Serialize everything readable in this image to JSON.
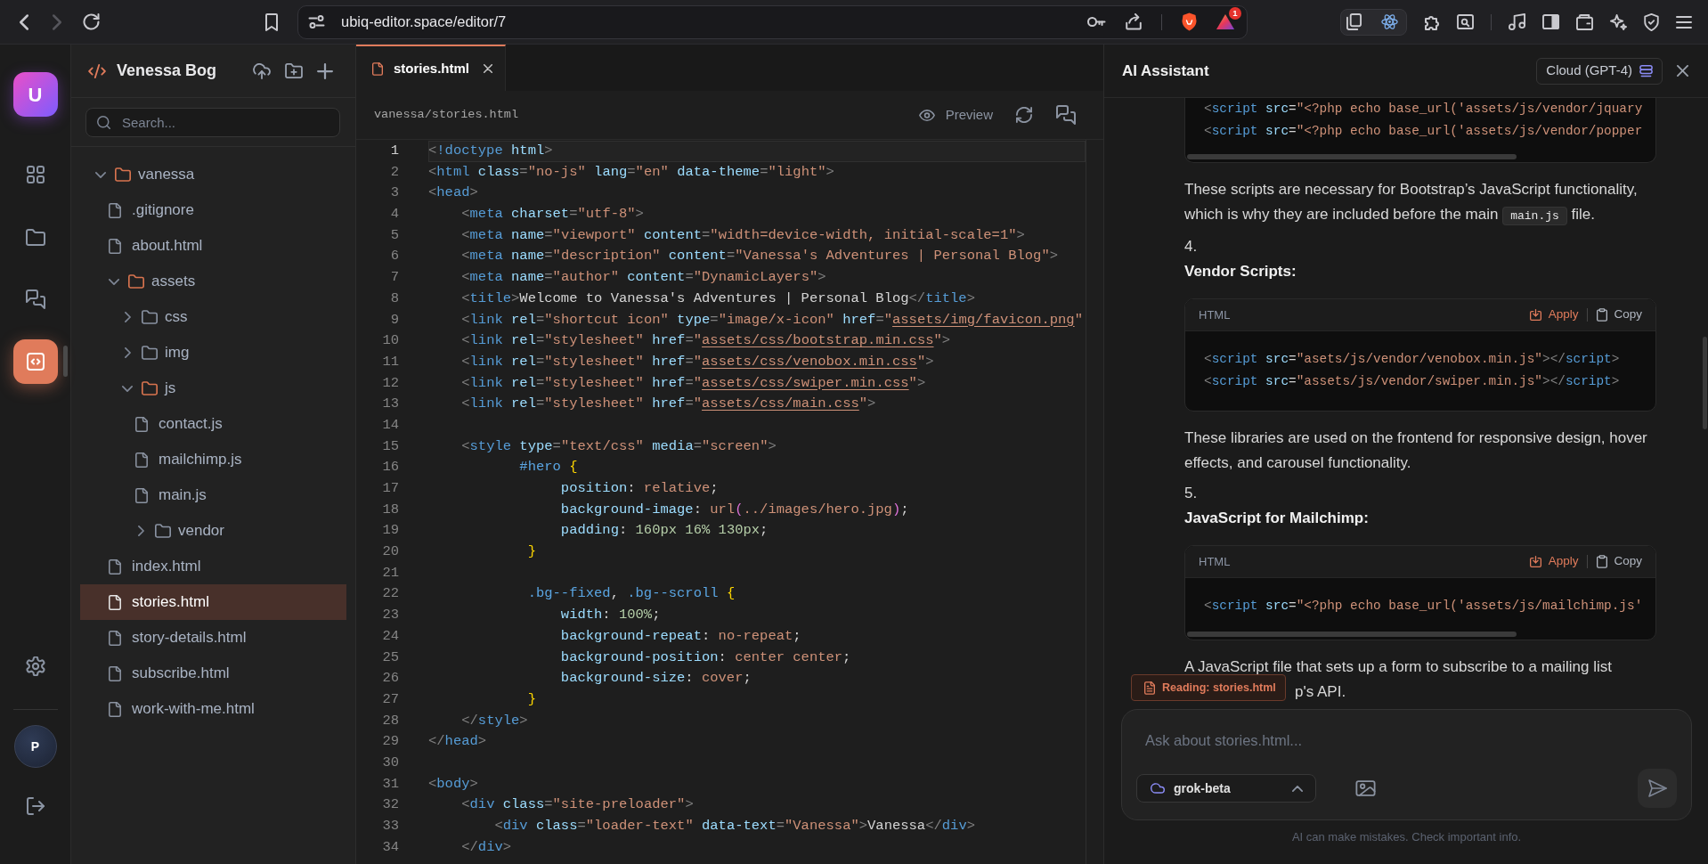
{
  "browser": {
    "url": "ubiq-editor.space/editor/7",
    "forward_disabled": true,
    "rewards_badge": "1"
  },
  "rail": {
    "logo": "U",
    "items": [
      {
        "kind": "grid",
        "selected": false
      },
      {
        "kind": "folder",
        "selected": false
      },
      {
        "kind": "chat",
        "selected": false
      },
      {
        "kind": "code",
        "selected": true
      }
    ],
    "avatar": "P"
  },
  "project": {
    "title": "Venessa Bog",
    "search_placeholder": "Search...",
    "tree": [
      {
        "name": "vanessa",
        "kind": "folder",
        "expanded": true,
        "selected": false,
        "children": [
          {
            "name": ".gitignore",
            "kind": "file",
            "selected": false
          },
          {
            "name": "about.html",
            "kind": "file",
            "selected": false
          },
          {
            "name": "assets",
            "kind": "folder",
            "expanded": true,
            "selected": false,
            "children": [
              {
                "name": "css",
                "kind": "folder",
                "expanded": false,
                "selected": false
              },
              {
                "name": "img",
                "kind": "folder",
                "expanded": false,
                "selected": false
              },
              {
                "name": "js",
                "kind": "folder",
                "expanded": true,
                "selected": false,
                "children": [
                  {
                    "name": "contact.js",
                    "kind": "file",
                    "selected": false
                  },
                  {
                    "name": "mailchimp.js",
                    "kind": "file",
                    "selected": false
                  },
                  {
                    "name": "main.js",
                    "kind": "file",
                    "selected": false
                  },
                  {
                    "name": "vendor",
                    "kind": "folder",
                    "expanded": false,
                    "selected": false
                  }
                ]
              }
            ]
          },
          {
            "name": "index.html",
            "kind": "file",
            "selected": false
          },
          {
            "name": "stories.html",
            "kind": "file",
            "selected": true
          },
          {
            "name": "story-details.html",
            "kind": "file",
            "selected": false
          },
          {
            "name": "subscribe.html",
            "kind": "file",
            "selected": false
          },
          {
            "name": "work-with-me.html",
            "kind": "file",
            "selected": false
          }
        ]
      }
    ]
  },
  "editor": {
    "tabs": [
      {
        "label": "stories.html",
        "selected": true
      }
    ],
    "path": "vanessa/stories.html",
    "preview": "Preview",
    "lines": [
      {
        "number": "1",
        "current": true,
        "tokens": [
          {
            "text": "<",
            "kind": "punct"
          },
          {
            "text": "!doctype",
            "kind": "tag"
          },
          {
            "text": " html",
            "kind": "attr"
          },
          {
            "text": ">",
            "kind": "punct"
          }
        ]
      },
      {
        "number": "2",
        "current": false,
        "tokens": [
          {
            "text": "<",
            "kind": "punct"
          },
          {
            "text": "html",
            "kind": "tag"
          },
          {
            "text": " class",
            "kind": "attr"
          },
          {
            "text": "=",
            "kind": "punct"
          },
          {
            "text": "\"no-js\"",
            "kind": "string"
          },
          {
            "text": " lang",
            "kind": "attr"
          },
          {
            "text": "=",
            "kind": "punct"
          },
          {
            "text": "\"en\"",
            "kind": "string"
          },
          {
            "text": " data-theme",
            "kind": "attr"
          },
          {
            "text": "=",
            "kind": "punct"
          },
          {
            "text": "\"light\"",
            "kind": "string"
          },
          {
            "text": ">",
            "kind": "punct"
          }
        ]
      },
      {
        "number": "3",
        "current": false,
        "tokens": [
          {
            "text": "<",
            "kind": "punct"
          },
          {
            "text": "head",
            "kind": "tag"
          },
          {
            "text": ">",
            "kind": "punct"
          }
        ]
      },
      {
        "number": "4",
        "current": false,
        "tokens": [
          {
            "text": "    <",
            "kind": "punct"
          },
          {
            "text": "meta",
            "kind": "tag"
          },
          {
            "text": " charset",
            "kind": "attr"
          },
          {
            "text": "=",
            "kind": "punct"
          },
          {
            "text": "\"utf-8\"",
            "kind": "string"
          },
          {
            "text": ">",
            "kind": "punct"
          }
        ]
      },
      {
        "number": "5",
        "current": false,
        "tokens": [
          {
            "text": "    <",
            "kind": "punct"
          },
          {
            "text": "meta",
            "kind": "tag"
          },
          {
            "text": " name",
            "kind": "attr"
          },
          {
            "text": "=",
            "kind": "punct"
          },
          {
            "text": "\"viewport\"",
            "kind": "string"
          },
          {
            "text": " content",
            "kind": "attr"
          },
          {
            "text": "=",
            "kind": "punct"
          },
          {
            "text": "\"width=device-width, initial-scale=1\"",
            "kind": "string"
          },
          {
            "text": ">",
            "kind": "punct"
          }
        ]
      },
      {
        "number": "6",
        "current": false,
        "tokens": [
          {
            "text": "    <",
            "kind": "punct"
          },
          {
            "text": "meta",
            "kind": "tag"
          },
          {
            "text": " name",
            "kind": "attr"
          },
          {
            "text": "=",
            "kind": "punct"
          },
          {
            "text": "\"description\"",
            "kind": "string"
          },
          {
            "text": " content",
            "kind": "attr"
          },
          {
            "text": "=",
            "kind": "punct"
          },
          {
            "text": "\"Vanessa's Adventures | Personal Blog\"",
            "kind": "string"
          },
          {
            "text": ">",
            "kind": "punct"
          }
        ]
      },
      {
        "number": "7",
        "current": false,
        "tokens": [
          {
            "text": "    <",
            "kind": "punct"
          },
          {
            "text": "meta",
            "kind": "tag"
          },
          {
            "text": " name",
            "kind": "attr"
          },
          {
            "text": "=",
            "kind": "punct"
          },
          {
            "text": "\"author\"",
            "kind": "string"
          },
          {
            "text": " content",
            "kind": "attr"
          },
          {
            "text": "=",
            "kind": "punct"
          },
          {
            "text": "\"DynamicLayers\"",
            "kind": "string"
          },
          {
            "text": ">",
            "kind": "punct"
          }
        ]
      },
      {
        "number": "8",
        "current": false,
        "tokens": [
          {
            "text": "    <",
            "kind": "punct"
          },
          {
            "text": "title",
            "kind": "tag"
          },
          {
            "text": ">",
            "kind": "punct"
          },
          {
            "text": "Welcome to Vanessa's Adventures | Personal Blog",
            "kind": "text"
          },
          {
            "text": "</",
            "kind": "punct"
          },
          {
            "text": "title",
            "kind": "tag"
          },
          {
            "text": ">",
            "kind": "punct"
          }
        ]
      },
      {
        "number": "9",
        "current": false,
        "tokens": [
          {
            "text": "    <",
            "kind": "punct"
          },
          {
            "text": "link",
            "kind": "tag"
          },
          {
            "text": " rel",
            "kind": "attr"
          },
          {
            "text": "=",
            "kind": "punct"
          },
          {
            "text": "\"shortcut icon\"",
            "kind": "string"
          },
          {
            "text": " type",
            "kind": "attr"
          },
          {
            "text": "=",
            "kind": "punct"
          },
          {
            "text": "\"image/x-icon\"",
            "kind": "string"
          },
          {
            "text": " href",
            "kind": "attr"
          },
          {
            "text": "=",
            "kind": "punct"
          },
          {
            "text": "\"",
            "kind": "string"
          },
          {
            "text": "assets/img/favicon.png",
            "kind": "link"
          },
          {
            "text": "\"",
            "kind": "string"
          }
        ]
      },
      {
        "number": "10",
        "current": false,
        "tokens": [
          {
            "text": "    <",
            "kind": "punct"
          },
          {
            "text": "link",
            "kind": "tag"
          },
          {
            "text": " rel",
            "kind": "attr"
          },
          {
            "text": "=",
            "kind": "punct"
          },
          {
            "text": "\"stylesheet\"",
            "kind": "string"
          },
          {
            "text": " href",
            "kind": "attr"
          },
          {
            "text": "=",
            "kind": "punct"
          },
          {
            "text": "\"",
            "kind": "string"
          },
          {
            "text": "assets/css/bootstrap.min.css",
            "kind": "link"
          },
          {
            "text": "\"",
            "kind": "string"
          },
          {
            "text": ">",
            "kind": "punct"
          }
        ]
      },
      {
        "number": "11",
        "current": false,
        "tokens": [
          {
            "text": "    <",
            "kind": "punct"
          },
          {
            "text": "link",
            "kind": "tag"
          },
          {
            "text": " rel",
            "kind": "attr"
          },
          {
            "text": "=",
            "kind": "punct"
          },
          {
            "text": "\"stylesheet\"",
            "kind": "string"
          },
          {
            "text": " href",
            "kind": "attr"
          },
          {
            "text": "=",
            "kind": "punct"
          },
          {
            "text": "\"",
            "kind": "string"
          },
          {
            "text": "assets/css/venobox.min.css",
            "kind": "link"
          },
          {
            "text": "\"",
            "kind": "string"
          },
          {
            "text": ">",
            "kind": "punct"
          }
        ]
      },
      {
        "number": "12",
        "current": false,
        "tokens": [
          {
            "text": "    <",
            "kind": "punct"
          },
          {
            "text": "link",
            "kind": "tag"
          },
          {
            "text": " rel",
            "kind": "attr"
          },
          {
            "text": "=",
            "kind": "punct"
          },
          {
            "text": "\"stylesheet\"",
            "kind": "string"
          },
          {
            "text": " href",
            "kind": "attr"
          },
          {
            "text": "=",
            "kind": "punct"
          },
          {
            "text": "\"",
            "kind": "string"
          },
          {
            "text": "assets/css/swiper.min.css",
            "kind": "link"
          },
          {
            "text": "\"",
            "kind": "string"
          },
          {
            "text": ">",
            "kind": "punct"
          }
        ]
      },
      {
        "number": "13",
        "current": false,
        "tokens": [
          {
            "text": "    <",
            "kind": "punct"
          },
          {
            "text": "link",
            "kind": "tag"
          },
          {
            "text": " rel",
            "kind": "attr"
          },
          {
            "text": "=",
            "kind": "punct"
          },
          {
            "text": "\"stylesheet\"",
            "kind": "string"
          },
          {
            "text": " href",
            "kind": "attr"
          },
          {
            "text": "=",
            "kind": "punct"
          },
          {
            "text": "\"",
            "kind": "string"
          },
          {
            "text": "assets/css/main.css",
            "kind": "link"
          },
          {
            "text": "\"",
            "kind": "string"
          },
          {
            "text": ">",
            "kind": "punct"
          }
        ]
      },
      {
        "number": "14",
        "current": false
      },
      {
        "number": "15",
        "current": false,
        "tokens": [
          {
            "text": "    <",
            "kind": "punct"
          },
          {
            "text": "style",
            "kind": "tag"
          },
          {
            "text": " type",
            "kind": "attr"
          },
          {
            "text": "=",
            "kind": "punct"
          },
          {
            "text": "\"text/css\"",
            "kind": "string"
          },
          {
            "text": " media",
            "kind": "attr"
          },
          {
            "text": "=",
            "kind": "punct"
          },
          {
            "text": "\"screen\"",
            "kind": "string"
          },
          {
            "text": ">",
            "kind": "punct"
          }
        ]
      },
      {
        "number": "16",
        "current": false,
        "tokens": [
          {
            "text": "           #hero",
            "kind": "selector"
          },
          {
            "text": " {",
            "kind": "brace"
          }
        ]
      },
      {
        "number": "17",
        "current": false,
        "tokens": [
          {
            "text": "                position",
            "kind": "property"
          },
          {
            "text": ": ",
            "kind": "plain"
          },
          {
            "text": "relative",
            "kind": "value"
          },
          {
            "text": ";",
            "kind": "plain"
          }
        ]
      },
      {
        "number": "18",
        "current": false,
        "tokens": [
          {
            "text": "                background-image",
            "kind": "property"
          },
          {
            "text": ": ",
            "kind": "plain"
          },
          {
            "text": "url",
            "kind": "value"
          },
          {
            "text": "(",
            "kind": "paren"
          },
          {
            "text": "../images/hero.jpg",
            "kind": "value"
          },
          {
            "text": ")",
            "kind": "paren"
          },
          {
            "text": ";",
            "kind": "plain"
          }
        ]
      },
      {
        "number": "19",
        "current": false,
        "tokens": [
          {
            "text": "                padding",
            "kind": "property"
          },
          {
            "text": ": ",
            "kind": "plain"
          },
          {
            "text": "160px 16% 130px",
            "kind": "number"
          },
          {
            "text": ";",
            "kind": "plain"
          }
        ]
      },
      {
        "number": "20",
        "current": false,
        "tokens": [
          {
            "text": "            }",
            "kind": "brace"
          }
        ]
      },
      {
        "number": "21",
        "current": false
      },
      {
        "number": "22",
        "current": false,
        "tokens": [
          {
            "text": "            .bg--fixed",
            "kind": "selector"
          },
          {
            "text": ", ",
            "kind": "plain"
          },
          {
            "text": ".bg--scroll",
            "kind": "selector"
          },
          {
            "text": " {",
            "kind": "brace"
          }
        ]
      },
      {
        "number": "23",
        "current": false,
        "tokens": [
          {
            "text": "                width",
            "kind": "property"
          },
          {
            "text": ": ",
            "kind": "plain"
          },
          {
            "text": "100%",
            "kind": "number"
          },
          {
            "text": ";",
            "kind": "plain"
          }
        ]
      },
      {
        "number": "24",
        "current": false,
        "tokens": [
          {
            "text": "                background-repeat",
            "kind": "property"
          },
          {
            "text": ": ",
            "kind": "plain"
          },
          {
            "text": "no-repeat",
            "kind": "value"
          },
          {
            "text": ";",
            "kind": "plain"
          }
        ]
      },
      {
        "number": "25",
        "current": false,
        "tokens": [
          {
            "text": "                background-position",
            "kind": "property"
          },
          {
            "text": ": ",
            "kind": "plain"
          },
          {
            "text": "center center",
            "kind": "value"
          },
          {
            "text": ";",
            "kind": "plain"
          }
        ]
      },
      {
        "number": "26",
        "current": false,
        "tokens": [
          {
            "text": "                background-size",
            "kind": "property"
          },
          {
            "text": ": ",
            "kind": "plain"
          },
          {
            "text": "cover",
            "kind": "value"
          },
          {
            "text": ";",
            "kind": "plain"
          }
        ]
      },
      {
        "number": "27",
        "current": false,
        "tokens": [
          {
            "text": "            }",
            "kind": "brace"
          }
        ]
      },
      {
        "number": "28",
        "current": false,
        "tokens": [
          {
            "text": "    </",
            "kind": "punct"
          },
          {
            "text": "style",
            "kind": "tag"
          },
          {
            "text": ">",
            "kind": "punct"
          }
        ]
      },
      {
        "number": "29",
        "current": false,
        "tokens": [
          {
            "text": "</",
            "kind": "punct"
          },
          {
            "text": "head",
            "kind": "tag"
          },
          {
            "text": ">",
            "kind": "punct"
          }
        ]
      },
      {
        "number": "30",
        "current": false
      },
      {
        "number": "31",
        "current": false,
        "tokens": [
          {
            "text": "<",
            "kind": "punct"
          },
          {
            "text": "body",
            "kind": "tag"
          },
          {
            "text": ">",
            "kind": "punct"
          }
        ]
      },
      {
        "number": "32",
        "current": false,
        "tokens": [
          {
            "text": "    <",
            "kind": "punct"
          },
          {
            "text": "div",
            "kind": "tag"
          },
          {
            "text": " class",
            "kind": "attr"
          },
          {
            "text": "=",
            "kind": "punct"
          },
          {
            "text": "\"site-preloader\"",
            "kind": "string"
          },
          {
            "text": ">",
            "kind": "punct"
          }
        ]
      },
      {
        "number": "33",
        "current": false,
        "tokens": [
          {
            "text": "        <",
            "kind": "punct"
          },
          {
            "text": "div",
            "kind": "tag"
          },
          {
            "text": " class",
            "kind": "attr"
          },
          {
            "text": "=",
            "kind": "punct"
          },
          {
            "text": "\"loader-text\"",
            "kind": "string"
          },
          {
            "text": " data-text",
            "kind": "attr"
          },
          {
            "text": "=",
            "kind": "punct"
          },
          {
            "text": "\"Vanessa\"",
            "kind": "string"
          },
          {
            "text": ">",
            "kind": "punct"
          },
          {
            "text": "Vanessa",
            "kind": "text"
          },
          {
            "text": "</",
            "kind": "punct"
          },
          {
            "text": "div",
            "kind": "tag"
          },
          {
            "text": ">",
            "kind": "punct"
          }
        ]
      },
      {
        "number": "34",
        "current": false,
        "tokens": [
          {
            "text": "    </",
            "kind": "punct"
          },
          {
            "text": "div",
            "kind": "tag"
          },
          {
            "text": ">",
            "kind": "punct"
          }
        ]
      }
    ]
  },
  "assistant": {
    "title": "AI Assistant",
    "model_badge": "Cloud (GPT-4)",
    "blocks": [
      {
        "kind": "code",
        "scrollbar": true,
        "lines": [
          {
            "tokens": [
              {
                "text": "<",
                "kind": "punct"
              },
              {
                "text": "script",
                "kind": "tag"
              },
              {
                "text": " src",
                "kind": "attr"
              },
              {
                "text": "=",
                "kind": "plain"
              },
              {
                "text": "\"<?php echo base_url('assets/js/vendor/jquary",
                "kind": "string"
              }
            ]
          },
          {
            "tokens": [
              {
                "text": "<",
                "kind": "punct"
              },
              {
                "text": "script",
                "kind": "tag"
              },
              {
                "text": " src",
                "kind": "attr"
              },
              {
                "text": "=",
                "kind": "plain"
              },
              {
                "text": "\"<?php echo base_url('assets/js/vendor/popper",
                "kind": "string"
              }
            ]
          }
        ]
      },
      {
        "kind": "paragraph",
        "parts": [
          {
            "kind": "text",
            "text": "These scripts are necessary for Bootstrap’s JavaScript functionality, which is why they are included before the main "
          },
          {
            "kind": "code",
            "text": "main.js"
          },
          {
            "kind": "text",
            "text": " file."
          }
        ]
      },
      {
        "kind": "marker",
        "text": "4."
      },
      {
        "kind": "heading",
        "text": "Vendor Scripts:"
      },
      {
        "kind": "code",
        "language": "HTML",
        "apply": "Apply",
        "copy": "Copy",
        "scrollbar": false,
        "lines": [
          {
            "tokens": [
              {
                "text": "<",
                "kind": "punct"
              },
              {
                "text": "script",
                "kind": "tag"
              },
              {
                "text": " src",
                "kind": "attr"
              },
              {
                "text": "=",
                "kind": "plain"
              },
              {
                "text": "\"asets/js/vendor/venobox.min.js\"",
                "kind": "string"
              },
              {
                "text": "></",
                "kind": "punct"
              },
              {
                "text": "script",
                "kind": "tag"
              },
              {
                "text": ">",
                "kind": "punct"
              }
            ]
          },
          {
            "tokens": [
              {
                "text": "<",
                "kind": "punct"
              },
              {
                "text": "script",
                "kind": "tag"
              },
              {
                "text": " src",
                "kind": "attr"
              },
              {
                "text": "=",
                "kind": "plain"
              },
              {
                "text": "\"assets/js/vendor/swiper.min.js\"",
                "kind": "string"
              },
              {
                "text": "></",
                "kind": "punct"
              },
              {
                "text": "script",
                "kind": "tag"
              },
              {
                "text": ">",
                "kind": "punct"
              }
            ]
          }
        ]
      },
      {
        "kind": "paragraph",
        "parts": [
          {
            "kind": "text",
            "text": "These libraries are used on the frontend for responsive design, hover effects, and carousel functionality."
          }
        ]
      },
      {
        "kind": "marker",
        "text": "5."
      },
      {
        "kind": "heading",
        "text": "JavaScript for Mailchimp:"
      },
      {
        "kind": "code",
        "language": "HTML",
        "apply": "Apply",
        "copy": "Copy",
        "scrollbar": true,
        "lines": [
          {
            "tokens": [
              {
                "text": "<",
                "kind": "punct"
              },
              {
                "text": "script",
                "kind": "tag"
              },
              {
                "text": " src",
                "kind": "attr"
              },
              {
                "text": "=",
                "kind": "plain"
              },
              {
                "text": "\"<?php echo base_url('assets/js/mailchimp.js'",
                "kind": "string"
              }
            ]
          }
        ]
      },
      {
        "kind": "paragraph",
        "parts": [
          {
            "kind": "text",
            "text": "A JavaScript file that sets up a form to subscribe to a mailing list"
          }
        ]
      },
      {
        "kind": "covered_line",
        "text": "p's API."
      }
    ],
    "reading_chip": "Reading: stories.html",
    "input_placeholder": "Ask about stories.html...",
    "model": "grok-beta",
    "disclaimer": "AI can make mistakes. Check important info."
  }
}
